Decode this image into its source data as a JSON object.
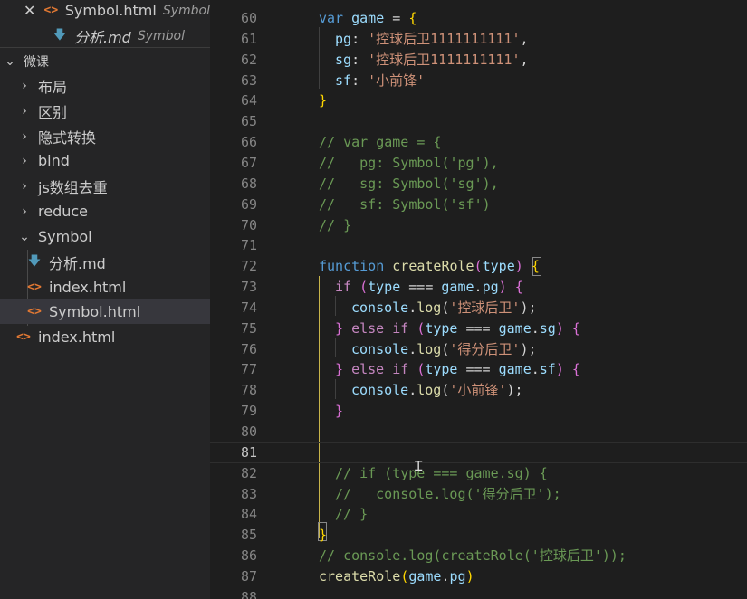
{
  "explorer": {
    "open_editors": [
      {
        "name": "Symbol.html",
        "description": "Symbol",
        "type": "html",
        "active": true
      },
      {
        "name": "分析.md",
        "description": "Symbol",
        "type": "md",
        "active": false
      }
    ],
    "root_folder": "微课",
    "folders": [
      "布局",
      "区别",
      "隐式转换",
      "bind",
      "js数组去重",
      "reduce"
    ],
    "symbol_folder": {
      "name": "Symbol",
      "files": [
        {
          "name": "分析.md",
          "type": "md"
        },
        {
          "name": "index.html",
          "type": "html"
        },
        {
          "name": "Symbol.html",
          "type": "html",
          "selected": true
        }
      ]
    },
    "root_files": [
      {
        "name": "index.html",
        "type": "html"
      }
    ]
  },
  "editor": {
    "active_line": 81,
    "lines": [
      {
        "n": 60,
        "indent": 0,
        "tokens": [
          [
            "kw",
            "var "
          ],
          [
            "var",
            "game"
          ],
          [
            "plain",
            " = "
          ],
          [
            "br1",
            "{"
          ]
        ]
      },
      {
        "n": 61,
        "indent": 1,
        "tokens": [
          [
            "prop",
            "pg"
          ],
          [
            "plain",
            ": "
          ],
          [
            "str",
            "'控球后卫1111111111'"
          ],
          [
            "plain",
            ","
          ]
        ]
      },
      {
        "n": 62,
        "indent": 1,
        "tokens": [
          [
            "prop",
            "sg"
          ],
          [
            "plain",
            ": "
          ],
          [
            "str",
            "'控球后卫1111111111'"
          ],
          [
            "plain",
            ","
          ]
        ]
      },
      {
        "n": 63,
        "indent": 1,
        "tokens": [
          [
            "prop",
            "sf"
          ],
          [
            "plain",
            ": "
          ],
          [
            "str",
            "'小前锋'"
          ]
        ]
      },
      {
        "n": 64,
        "indent": 0,
        "tokens": [
          [
            "br1",
            "}"
          ]
        ]
      },
      {
        "n": 65,
        "indent": 0,
        "tokens": []
      },
      {
        "n": 66,
        "indent": 0,
        "tokens": [
          [
            "com",
            "// var game = {"
          ]
        ]
      },
      {
        "n": 67,
        "indent": 0,
        "tokens": [
          [
            "com",
            "//   pg: Symbol('pg'),"
          ]
        ]
      },
      {
        "n": 68,
        "indent": 0,
        "tokens": [
          [
            "com",
            "//   sg: Symbol('sg'),"
          ]
        ]
      },
      {
        "n": 69,
        "indent": 0,
        "tokens": [
          [
            "com",
            "//   sf: Symbol('sf')"
          ]
        ]
      },
      {
        "n": 70,
        "indent": 0,
        "tokens": [
          [
            "com",
            "// }"
          ]
        ]
      },
      {
        "n": 71,
        "indent": 0,
        "tokens": []
      },
      {
        "n": 72,
        "indent": 0,
        "tokens": [
          [
            "kw",
            "function "
          ],
          [
            "fn",
            "createRole"
          ],
          [
            "br2",
            "("
          ],
          [
            "var",
            "type"
          ],
          [
            "br2",
            ")"
          ],
          [
            "plain",
            " "
          ],
          [
            "br1",
            "{"
          ]
        ]
      },
      {
        "n": 73,
        "indent": 1,
        "tokens": [
          [
            "ctl",
            "if "
          ],
          [
            "br2",
            "("
          ],
          [
            "var",
            "type"
          ],
          [
            "plain",
            " === "
          ],
          [
            "var",
            "game"
          ],
          [
            "plain",
            "."
          ],
          [
            "prop",
            "pg"
          ],
          [
            "br2",
            ")"
          ],
          [
            "plain",
            " "
          ],
          [
            "br2",
            "{"
          ]
        ]
      },
      {
        "n": 74,
        "indent": 2,
        "tokens": [
          [
            "var",
            "console"
          ],
          [
            "plain",
            "."
          ],
          [
            "fn",
            "log"
          ],
          [
            "plain",
            "("
          ],
          [
            "str",
            "'控球后卫'"
          ],
          [
            "plain",
            ");"
          ]
        ]
      },
      {
        "n": 75,
        "indent": 1,
        "tokens": [
          [
            "br2",
            "}"
          ],
          [
            "plain",
            " "
          ],
          [
            "ctl",
            "else if "
          ],
          [
            "br2",
            "("
          ],
          [
            "var",
            "type"
          ],
          [
            "plain",
            " === "
          ],
          [
            "var",
            "game"
          ],
          [
            "plain",
            "."
          ],
          [
            "prop",
            "sg"
          ],
          [
            "br2",
            ")"
          ],
          [
            "plain",
            " "
          ],
          [
            "br2",
            "{"
          ]
        ]
      },
      {
        "n": 76,
        "indent": 2,
        "tokens": [
          [
            "var",
            "console"
          ],
          [
            "plain",
            "."
          ],
          [
            "fn",
            "log"
          ],
          [
            "plain",
            "("
          ],
          [
            "str",
            "'得分后卫'"
          ],
          [
            "plain",
            ");"
          ]
        ]
      },
      {
        "n": 77,
        "indent": 1,
        "tokens": [
          [
            "br2",
            "}"
          ],
          [
            "plain",
            " "
          ],
          [
            "ctl",
            "else if "
          ],
          [
            "br2",
            "("
          ],
          [
            "var",
            "type"
          ],
          [
            "plain",
            " === "
          ],
          [
            "var",
            "game"
          ],
          [
            "plain",
            "."
          ],
          [
            "prop",
            "sf"
          ],
          [
            "br2",
            ")"
          ],
          [
            "plain",
            " "
          ],
          [
            "br2",
            "{"
          ]
        ]
      },
      {
        "n": 78,
        "indent": 2,
        "tokens": [
          [
            "var",
            "console"
          ],
          [
            "plain",
            "."
          ],
          [
            "fn",
            "log"
          ],
          [
            "plain",
            "("
          ],
          [
            "str",
            "'小前锋'"
          ],
          [
            "plain",
            ");"
          ]
        ]
      },
      {
        "n": 79,
        "indent": 1,
        "tokens": [
          [
            "br2",
            "}"
          ]
        ]
      },
      {
        "n": 80,
        "indent": 0,
        "tokens": []
      },
      {
        "n": 81,
        "indent": 0,
        "tokens": []
      },
      {
        "n": 82,
        "indent": 1,
        "tokens": [
          [
            "com",
            "// if (type === game.sg) {"
          ]
        ]
      },
      {
        "n": 83,
        "indent": 1,
        "tokens": [
          [
            "com",
            "//   console.log('得分后卫');"
          ]
        ]
      },
      {
        "n": 84,
        "indent": 1,
        "tokens": [
          [
            "com",
            "// }"
          ]
        ]
      },
      {
        "n": 85,
        "indent": 0,
        "tokens": [
          [
            "br1",
            "}"
          ]
        ]
      },
      {
        "n": 86,
        "indent": 0,
        "tokens": [
          [
            "com",
            "// console.log(createRole('控球后卫'));"
          ]
        ]
      },
      {
        "n": 87,
        "indent": 0,
        "tokens": [
          [
            "fn",
            "createRole"
          ],
          [
            "br1",
            "("
          ],
          [
            "var",
            "game"
          ],
          [
            "plain",
            "."
          ],
          [
            "prop",
            "pg"
          ],
          [
            "br1",
            ")"
          ]
        ]
      },
      {
        "n": 88,
        "indent": 0,
        "tokens": []
      }
    ]
  }
}
